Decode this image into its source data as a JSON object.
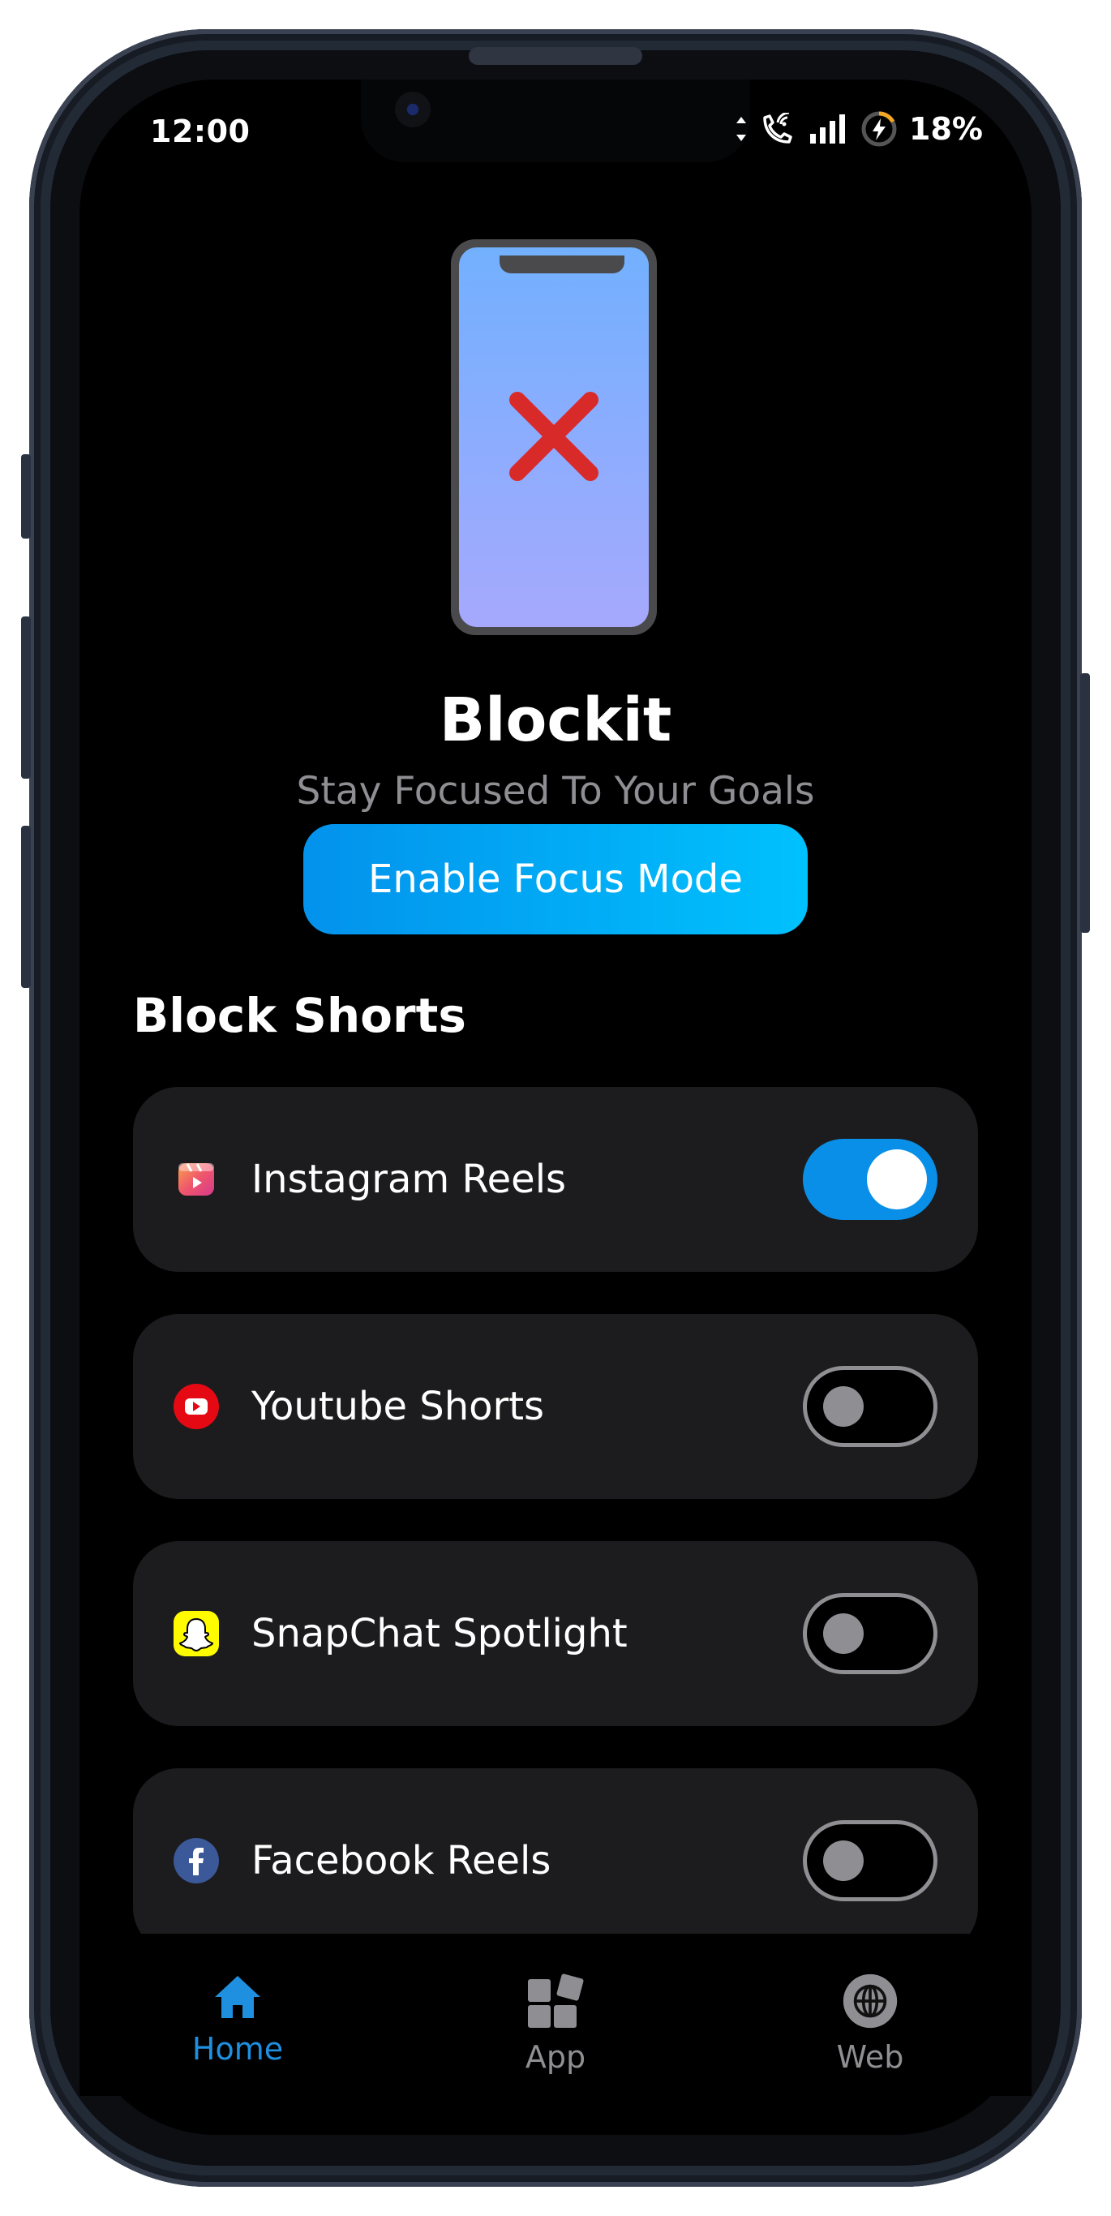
{
  "status_bar": {
    "time": "12:00",
    "battery": "18%"
  },
  "hero": {
    "title": "Blockit",
    "subtitle": "Stay Focused To Your Goals"
  },
  "focus_button": {
    "label": "Enable Focus Mode"
  },
  "section": {
    "title": "Block Shorts"
  },
  "items": [
    {
      "label": "Instagram Reels",
      "icon": "instagram-reels-icon",
      "enabled": true
    },
    {
      "label": "Youtube Shorts",
      "icon": "youtube-icon",
      "enabled": false
    },
    {
      "label": "SnapChat Spotlight",
      "icon": "snapchat-icon",
      "enabled": false
    },
    {
      "label": "Facebook Reels",
      "icon": "facebook-icon",
      "enabled": false
    }
  ],
  "nav": [
    {
      "label": "Home",
      "icon": "home-icon",
      "active": true
    },
    {
      "label": "App",
      "icon": "apps-grid-icon",
      "active": false
    },
    {
      "label": "Web",
      "icon": "globe-icon",
      "active": false
    }
  ],
  "colors": {
    "accent": "#0a8fe8",
    "button_gradient_start": "#0392ec",
    "button_gradient_end": "#00c1fd",
    "card_bg": "#1c1c1e",
    "muted_text": "#8e8e93",
    "nav_active": "#1f8fe0",
    "nav_inactive": "#8e8e93"
  }
}
